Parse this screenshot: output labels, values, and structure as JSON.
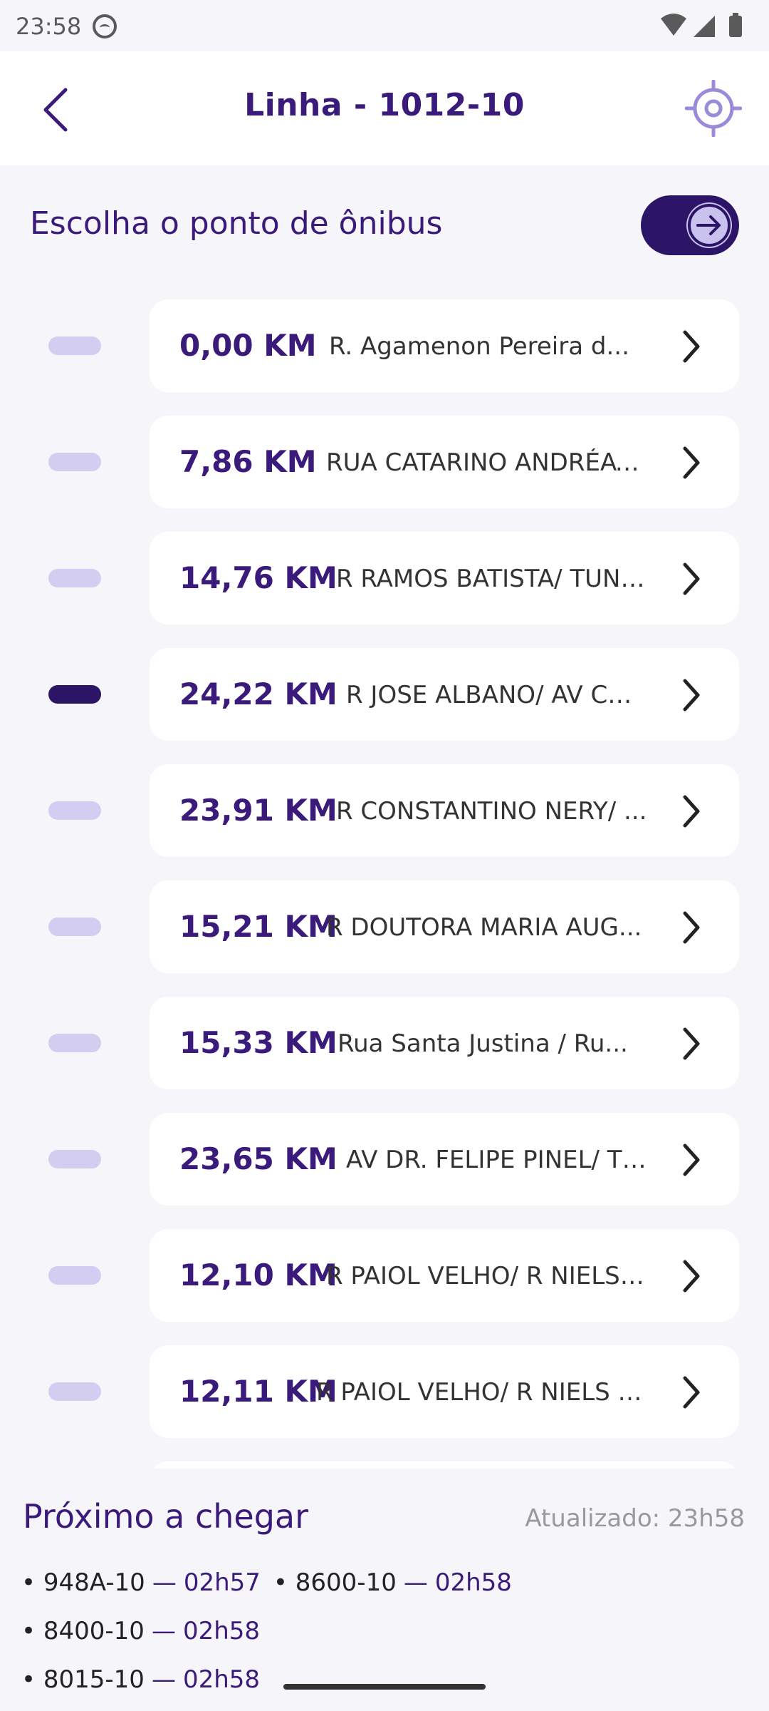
{
  "status_bar": {
    "time": "23:58"
  },
  "header": {
    "title": "Linha - 1012-10"
  },
  "section": {
    "title": "Escolha o ponto de ônibus"
  },
  "stops": [
    {
      "km": "0,00 KM",
      "name": "R. Agamenon Pereira d...",
      "active": false
    },
    {
      "km": "7,86 KM",
      "name": "RUA CATARINO ANDRÉAT...",
      "active": false
    },
    {
      "km": "14,76 KM",
      "name": "R RAMOS BATISTA/ TUNE...",
      "active": false
    },
    {
      "km": "24,22 KM",
      "name": "R JOSE ALBANO/ AV CB....",
      "active": true
    },
    {
      "km": "23,91 KM",
      "name": "R CONSTANTINO NERY/ ...",
      "active": false
    },
    {
      "km": "15,21 KM",
      "name": "R DOUTORA MARIA AUG...",
      "active": false
    },
    {
      "km": "15,33 KM",
      "name": "Rua Santa Justina / Ru...",
      "active": false
    },
    {
      "km": "23,65 KM",
      "name": "AV DR. FELIPE PINEL/ TE...",
      "active": false
    },
    {
      "km": "12,10 KM",
      "name": "R PAIOL VELHO/ R NIELS ...",
      "active": false
    },
    {
      "km": "12,11 KM",
      "name": "R PAIOL VELHO/ R NIELS C...",
      "active": false
    }
  ],
  "footer": {
    "title": "Próximo a chegar",
    "updated": "Atualizado: 23h58",
    "arrivals": [
      {
        "line": "948A-10",
        "time": "02h57"
      },
      {
        "line": "8600-10",
        "time": "02h58"
      },
      {
        "line": "8400-10",
        "time": "02h58"
      },
      {
        "line": "8015-10",
        "time": "02h58"
      }
    ]
  },
  "colors": {
    "primary": "#2c1566",
    "accent_light": "#d3cdf2",
    "background": "#f6f6fa"
  },
  "icons": [
    "back-arrow-icon",
    "locate-icon",
    "arrow-right-circle-icon",
    "chevron-right-icon"
  ]
}
